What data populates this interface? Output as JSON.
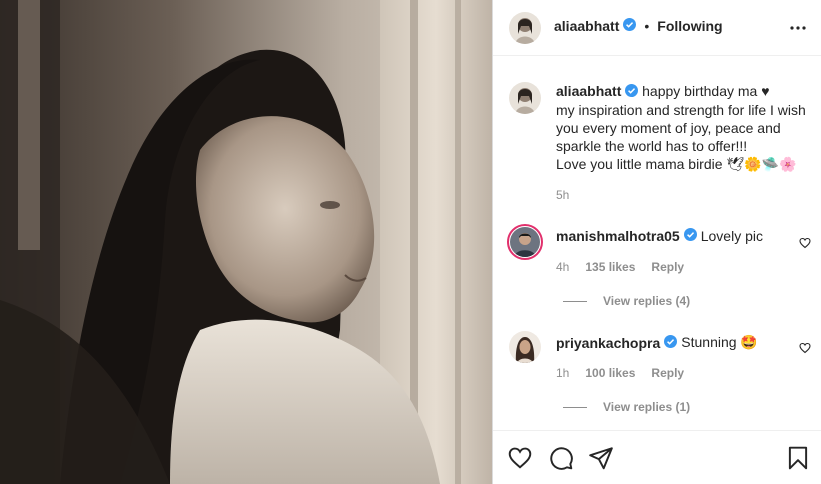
{
  "post": {
    "author": "aliaabhatt",
    "separator": "•",
    "follow_status": "Following",
    "caption": {
      "first_line": "happy birthday ma ♥",
      "body_lines": [
        "my inspiration and strength for life I wish",
        "you every moment of joy, peace and",
        "sparkle the world has to offer!!!",
        "Love you little mama birdie 🕊🌼🛸🌸"
      ],
      "time": "5h"
    }
  },
  "comments": [
    {
      "user": "manishmalhotra05",
      "text": "Lovely pic",
      "time": "4h",
      "likes": "135 likes",
      "reply": "Reply",
      "view_replies": "View replies (4)"
    },
    {
      "user": "priyankachopra",
      "text": "Stunning 🤩",
      "time": "1h",
      "likes": "100 likes",
      "reply": "Reply",
      "view_replies": "View replies (1)"
    }
  ],
  "icons": {
    "more": "more-options-icon",
    "verified": "verified-badge-icon",
    "like": "heart-icon",
    "comment": "comment-icon",
    "share": "send-icon",
    "save": "bookmark-icon"
  },
  "colors": {
    "verified": "#3897f0",
    "text": "#262626",
    "muted": "#8e8e8e",
    "border": "#dbdbdb"
  }
}
